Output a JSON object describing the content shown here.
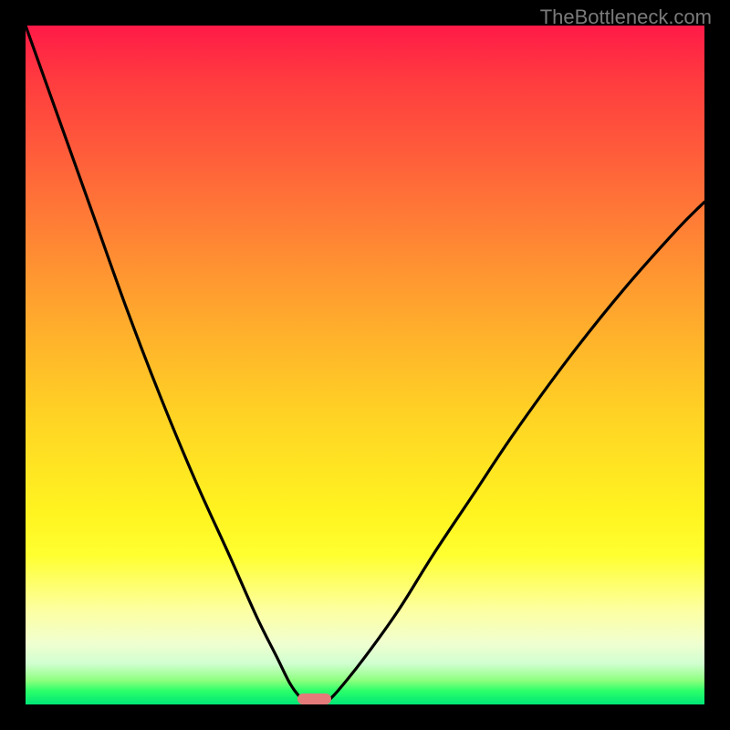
{
  "watermark": "TheBottleneck.com",
  "chart_data": {
    "type": "line",
    "title": "",
    "xlabel": "",
    "ylabel": "",
    "xlim": [
      0,
      100
    ],
    "ylim": [
      0,
      100
    ],
    "grid": false,
    "legend": false,
    "background_gradient": {
      "top": "#ff1a48",
      "mid_upper": "#ff9a30",
      "mid": "#ffe722",
      "mid_lower": "#fdffa0",
      "bottom": "#00e676"
    },
    "series": [
      {
        "name": "left-curve",
        "x": [
          0,
          5,
          10,
          15,
          20,
          25,
          30,
          34,
          37,
          39,
          40.5,
          41.5,
          42
        ],
        "y": [
          100,
          86,
          72,
          58,
          45,
          33,
          22,
          13,
          7,
          3,
          1,
          0.2,
          0
        ]
      },
      {
        "name": "right-curve",
        "x": [
          44,
          46,
          50,
          55,
          60,
          66,
          72,
          80,
          88,
          96,
          100
        ],
        "y": [
          0,
          2,
          7,
          14,
          22,
          31,
          40,
          51,
          61,
          70,
          74
        ]
      }
    ],
    "marker": {
      "shape": "rounded-rect",
      "x": 42.5,
      "y": 0,
      "width_pct": 5.0,
      "height_pct": 1.6,
      "color": "#e47a7a"
    }
  },
  "layout": {
    "image_size": 800,
    "frame_inset": 28
  }
}
